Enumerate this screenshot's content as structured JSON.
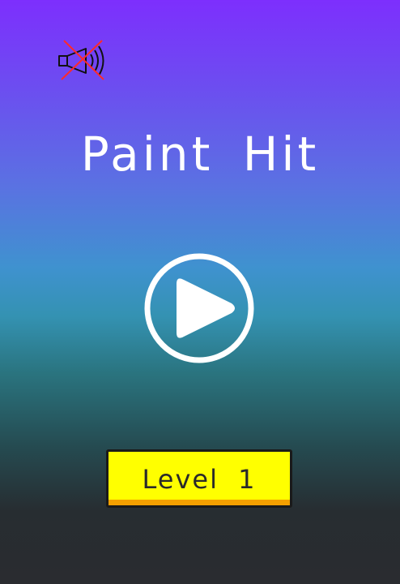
{
  "game": {
    "title": "Paint Hit",
    "level_label": "Level 1"
  },
  "sound_button": {
    "icon": "speaker-muted-icon",
    "state": "muted"
  },
  "play_button": {
    "icon": "play-icon"
  },
  "colors": {
    "gradient_top": "#7d2ffd",
    "gradient_mid": "#3f92cf",
    "gradient_bottom": "#2a2c30",
    "level_button_fill": "#ffff00",
    "level_button_edge": "#f4a000",
    "mute_cross": "#ff2a2a"
  }
}
